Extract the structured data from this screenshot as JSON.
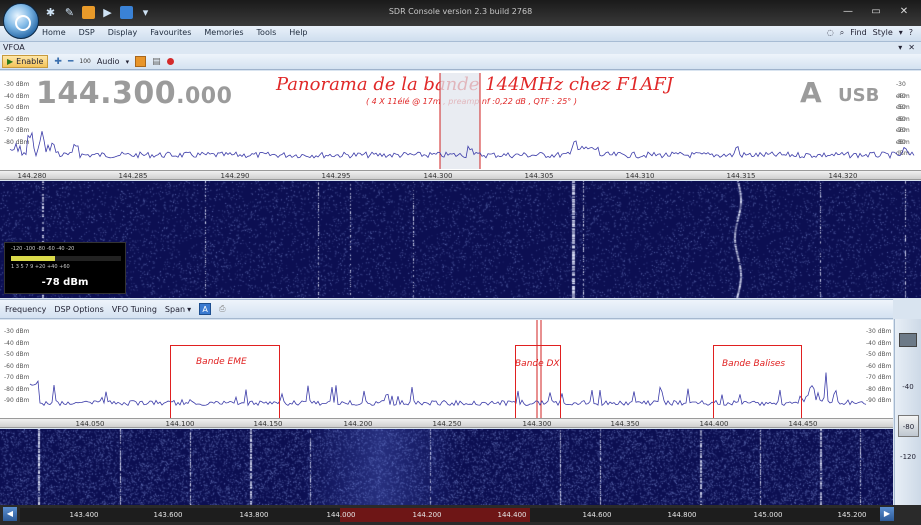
{
  "titlebar": {
    "title": "SDR Console version 2.3 build 2768",
    "controls": [
      "—",
      "▭",
      "✕"
    ]
  },
  "menu": {
    "items": [
      "Home",
      "DSP",
      "Display",
      "Favourites",
      "Memories",
      "Tools",
      "Help"
    ],
    "find": "Find",
    "style": "Style"
  },
  "vfo": {
    "label": "VFOA"
  },
  "toolbar": {
    "enable": "Enable",
    "zoom": "100",
    "audio": "Audio"
  },
  "top_panel": {
    "frequency_main": "144.300",
    "frequency_fraction": ".000",
    "vfo_letter": "A",
    "mode": "USB",
    "title": "Panorama de la bande 144MHz chez F1AFJ",
    "subtitle": "( 4 X 11élé @ 17m , preamp nf :0,22 dB , QTF : 25° )",
    "dbm_scale": [
      "-30 dBm",
      "-40 dBm",
      "-50 dBm",
      "-60 dBm",
      "-70 dBm",
      "-80 dBm"
    ],
    "axis_labels": [
      "144.280",
      "144.285",
      "144.290",
      "144.295",
      "144.300",
      "144.305",
      "144.310",
      "144.315",
      "144.320"
    ]
  },
  "smeter": {
    "scale_top": "-120  -100   -80   -60   -40   -20",
    "scale_bottom": "1   3   5   7   9   +20   +40   +60",
    "value": "-78 dBm",
    "level": 0.4
  },
  "sub_toolbar": {
    "items": [
      "Frequency",
      "DSP Options",
      "VFO Tuning",
      "Span"
    ],
    "a_button": "A"
  },
  "lower_panel": {
    "dbm_scale": [
      "-30 dBm",
      "-40 dBm",
      "-50 dBm",
      "-60 dBm",
      "-70 dBm",
      "-80 dBm",
      "-90 dBm"
    ],
    "axis_labels": [
      "144.050",
      "144.100",
      "144.150",
      "144.200",
      "144.250",
      "144.300",
      "144.350",
      "144.400",
      "144.450"
    ],
    "band_labels": {
      "eme": "Bande EME",
      "dx": "Bande DX",
      "beacons": "Bande Balises"
    }
  },
  "right_column": {
    "labels": [
      "-40",
      "-80",
      "-120"
    ]
  },
  "bottom_axis": {
    "labels": [
      "143.400",
      "143.600",
      "143.800",
      "144.000",
      "144.200",
      "144.400",
      "144.600",
      "144.800",
      "145.000",
      "145.200"
    ],
    "left_arrow": "◀",
    "right_arrow": "▶"
  },
  "colors": {
    "accent_red": "#e02020",
    "waterfall_bg": "#0c0f52",
    "spectrum_line": "#3b3ba8"
  }
}
